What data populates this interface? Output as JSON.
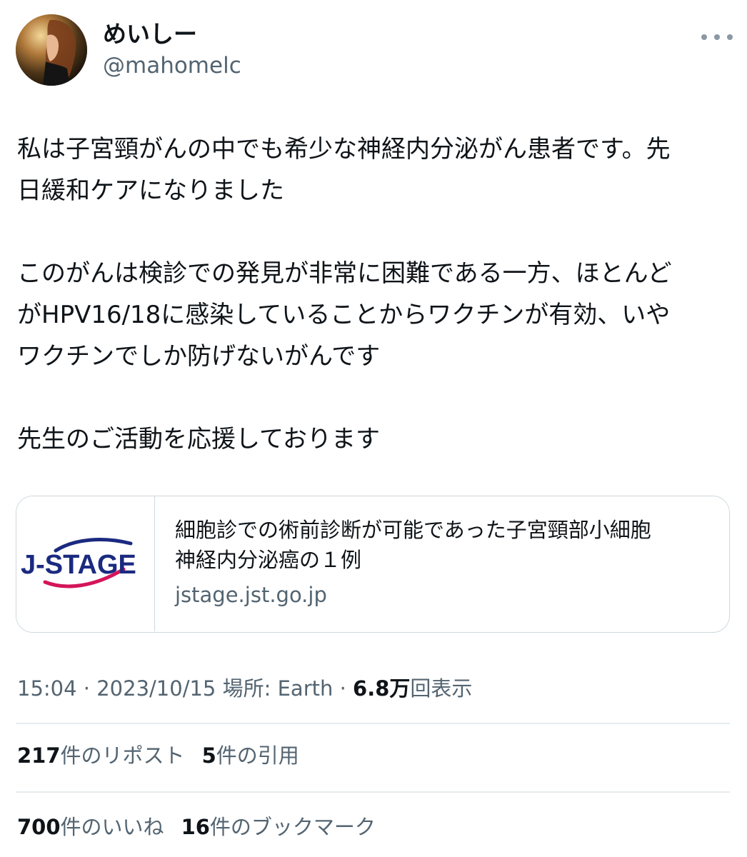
{
  "author": {
    "display_name": "めいしー",
    "handle": "@mahomelc"
  },
  "tweet": {
    "text": "私は子宮頸がんの中でも希少な神経内分泌がん患者です。先\n日緩和ケアになりました\n\nこのがんは検診での発見が非常に困難である一方、ほとんど\nがHPV16/18に感染していることからワクチンが有効、いや\nワクチンでしか防げないがんです\n\n先生のご活動を応援しております"
  },
  "card": {
    "logo_text": "J-STAGE",
    "title": "細胞診での術前診断が可能であった子宮頸部小細胞\n神経内分泌癌の１例",
    "domain": "jstage.jst.go.jp"
  },
  "meta": {
    "time": "15:04",
    "date": "2023/10/15",
    "location": "場所: Earth",
    "separator": "·",
    "views_count": "6.8万",
    "views_label": "回表示"
  },
  "stats": {
    "reposts_count": "217",
    "reposts_label": "件のリポスト",
    "quotes_count": "5",
    "quotes_label": "件の引用",
    "likes_count": "700",
    "likes_label": "件のいいね",
    "bookmarks_count": "16",
    "bookmarks_label": "件のブックマーク"
  },
  "colors": {
    "text_primary": "#0f1419",
    "text_secondary": "#536471",
    "border": "#cfd9de",
    "logo_blue": "#1b2a80",
    "logo_red": "#d4145a"
  }
}
